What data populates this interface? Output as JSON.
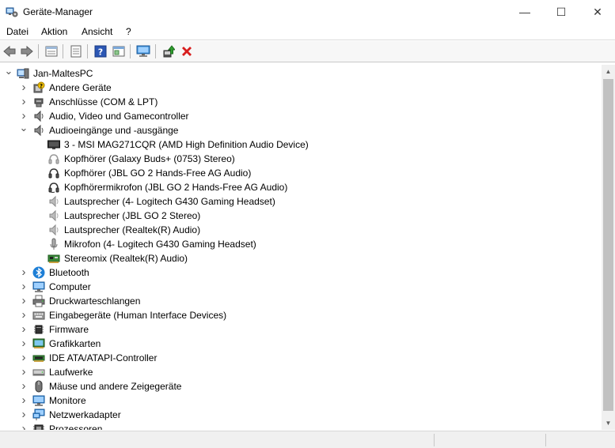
{
  "window": {
    "title": "Geräte-Manager",
    "min_glyph": "—",
    "max_glyph": "☐",
    "close_glyph": "✕"
  },
  "menu": [
    "Datei",
    "Aktion",
    "Ansicht",
    "?"
  ],
  "toolbar": {
    "icons": [
      "back-arrow-icon",
      "forward-arrow-icon",
      "properties-icon",
      "show-hidden-icon",
      "help-icon",
      "action-view-icon",
      "scan-hardware-icon",
      "update-driver-icon",
      "uninstall-icon"
    ]
  },
  "tree": {
    "expanded_glyph": "⌄",
    "collapsed_glyph": "›",
    "rows": [
      {
        "label": "Jan-MaltesPC",
        "level": 0,
        "state": "expanded",
        "icon": "computer-root-icon"
      },
      {
        "label": "Andere Geräte",
        "level": 1,
        "state": "collapsed",
        "icon": "unknown-device-icon"
      },
      {
        "label": "Anschlüsse (COM & LPT)",
        "level": 1,
        "state": "collapsed",
        "icon": "port-icon"
      },
      {
        "label": "Audio, Video und Gamecontroller",
        "level": 1,
        "state": "collapsed",
        "icon": "speaker-icon"
      },
      {
        "label": "Audioeingänge und -ausgänge",
        "level": 1,
        "state": "expanded",
        "icon": "speaker-icon"
      },
      {
        "label": "3 - MSI MAG271CQR (AMD High Definition Audio Device)",
        "level": 2,
        "state": "none",
        "icon": "monitor-audio-icon"
      },
      {
        "label": "Kopfhörer (Galaxy Buds+ (0753) Stereo)",
        "level": 2,
        "state": "none",
        "icon": "headphones-gray-icon"
      },
      {
        "label": "Kopfhörer (JBL GO 2 Hands-Free AG Audio)",
        "level": 2,
        "state": "none",
        "icon": "headphones-icon"
      },
      {
        "label": "Kopfhörermikrofon (JBL GO 2 Hands-Free AG Audio)",
        "level": 2,
        "state": "none",
        "icon": "headset-icon"
      },
      {
        "label": "Lautsprecher (4- Logitech G430 Gaming Headset)",
        "level": 2,
        "state": "none",
        "icon": "speaker-gray-icon"
      },
      {
        "label": "Lautsprecher (JBL GO 2 Stereo)",
        "level": 2,
        "state": "none",
        "icon": "speaker-gray-icon"
      },
      {
        "label": "Lautsprecher (Realtek(R) Audio)",
        "level": 2,
        "state": "none",
        "icon": "speaker-gray-icon"
      },
      {
        "label": "Mikrofon (4- Logitech G430 Gaming Headset)",
        "level": 2,
        "state": "none",
        "icon": "microphone-icon"
      },
      {
        "label": "Stereomix (Realtek(R) Audio)",
        "level": 2,
        "state": "none",
        "icon": "sound-card-icon"
      },
      {
        "label": "Bluetooth",
        "level": 1,
        "state": "collapsed",
        "icon": "bluetooth-icon"
      },
      {
        "label": "Computer",
        "level": 1,
        "state": "collapsed",
        "icon": "computer-icon"
      },
      {
        "label": "Druckwarteschlangen",
        "level": 1,
        "state": "collapsed",
        "icon": "printer-icon"
      },
      {
        "label": "Eingabegeräte (Human Interface Devices)",
        "level": 1,
        "state": "collapsed",
        "icon": "keyboard-icon"
      },
      {
        "label": "Firmware",
        "level": 1,
        "state": "collapsed",
        "icon": "chip-icon"
      },
      {
        "label": "Grafikkarten",
        "level": 1,
        "state": "collapsed",
        "icon": "display-adapter-icon"
      },
      {
        "label": "IDE ATA/ATAPI-Controller",
        "level": 1,
        "state": "collapsed",
        "icon": "ide-controller-icon"
      },
      {
        "label": "Laufwerke",
        "level": 1,
        "state": "collapsed",
        "icon": "disk-drive-icon"
      },
      {
        "label": "Mäuse und andere Zeigegeräte",
        "level": 1,
        "state": "collapsed",
        "icon": "mouse-icon"
      },
      {
        "label": "Monitore",
        "level": 1,
        "state": "collapsed",
        "icon": "monitor-icon"
      },
      {
        "label": "Netzwerkadapter",
        "level": 1,
        "state": "collapsed",
        "icon": "network-icon"
      },
      {
        "label": "Prozessoren",
        "level": 1,
        "state": "collapsed",
        "icon": "processor-icon"
      }
    ]
  },
  "scrollbar": {
    "up_glyph": "▲",
    "down_glyph": "▼"
  },
  "colors": {
    "accent_blue": "#1e7fd6",
    "close_red": "#d81e1e",
    "scan_green": "#2e8b2e"
  }
}
